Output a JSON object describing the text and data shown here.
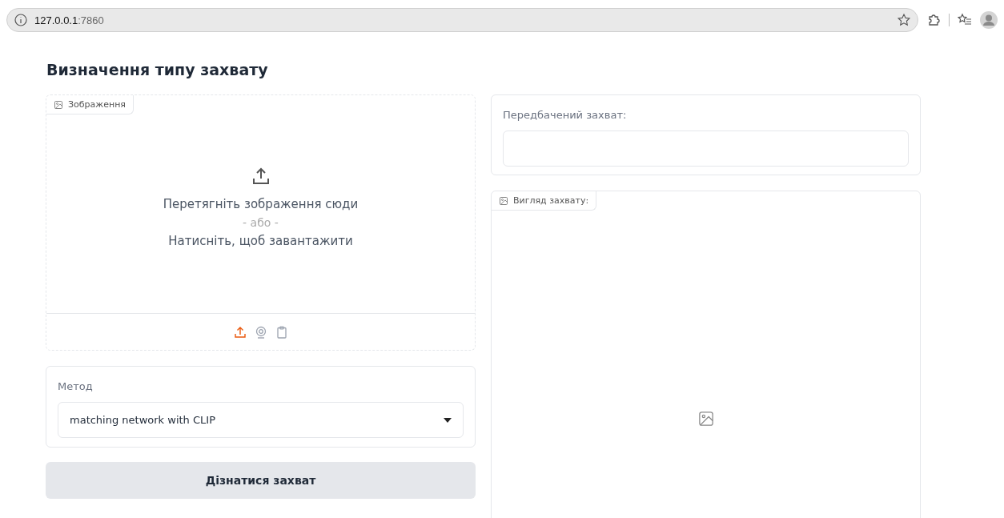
{
  "browser": {
    "address_host": "127.0.0.1",
    "address_port": ":7860"
  },
  "title": "Визначення типу захвату",
  "image_input": {
    "label": "Зображення",
    "drop_text": "Перетягніть зображення сюди",
    "or_text": "- або -",
    "click_text": "Натисніть, щоб завантажити",
    "sources": [
      {
        "kind": "upload",
        "selected": true
      },
      {
        "kind": "webcam",
        "selected": false
      },
      {
        "kind": "clipboard",
        "selected": false
      }
    ]
  },
  "method": {
    "label": "Метод",
    "value": "matching network with CLIP"
  },
  "submit_button": "Дізнатися захват",
  "prediction": {
    "label": "Передбачений захват:"
  },
  "grasp_view": {
    "label": "Вигляд захвату:"
  }
}
